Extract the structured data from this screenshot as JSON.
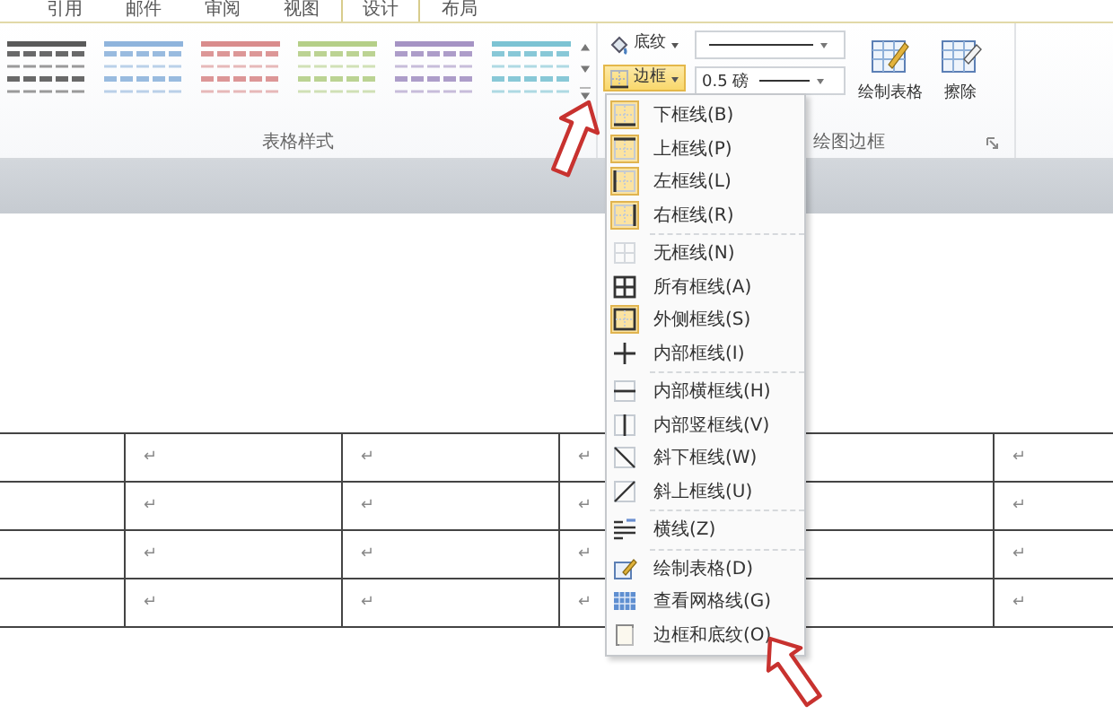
{
  "tabs": [
    {
      "label": "引用",
      "selected": false
    },
    {
      "label": "邮件",
      "selected": false
    },
    {
      "label": "审阅",
      "selected": false
    },
    {
      "label": "视图",
      "selected": false
    },
    {
      "label": "设计",
      "selected": true
    },
    {
      "label": "布局",
      "selected": false
    }
  ],
  "table_styles": {
    "styles": [
      {
        "color": "#5a5a5a"
      },
      {
        "color": "#8fb4dc"
      },
      {
        "color": "#d98c8c"
      },
      {
        "color": "#b5cf88"
      },
      {
        "color": "#a593c4"
      },
      {
        "color": "#7cc3d3"
      }
    ],
    "label": "表格样式"
  },
  "draw_borders": {
    "shading": "底纹",
    "borders": "边框",
    "line_weight": "0.5 磅",
    "draw_table": "绘制表格",
    "eraser": "擦除",
    "label": "绘图边框"
  },
  "menu": {
    "groups": [
      [
        {
          "label": "下框线(B)",
          "checked": true
        },
        {
          "label": "上框线(P)",
          "checked": true
        },
        {
          "label": "左框线(L)",
          "checked": true
        },
        {
          "label": "右框线(R)",
          "checked": true
        }
      ],
      [
        {
          "label": "无框线(N)",
          "checked": false
        },
        {
          "label": "所有框线(A)",
          "checked": false
        },
        {
          "label": "外侧框线(S)",
          "checked": true
        },
        {
          "label": "内部框线(I)",
          "checked": false
        }
      ],
      [
        {
          "label": "内部横框线(H)",
          "checked": false
        },
        {
          "label": "内部竖框线(V)",
          "checked": false
        },
        {
          "label": "斜下框线(W)",
          "checked": false
        },
        {
          "label": "斜上框线(U)",
          "checked": false
        }
      ],
      [
        {
          "label": "横线(Z)",
          "checked": false
        }
      ],
      [
        {
          "label": "绘制表格(D)",
          "checked": false
        },
        {
          "label": "查看网格线(G)",
          "checked": false
        },
        {
          "label": "边框和底纹(O)",
          "checked": false
        }
      ]
    ]
  },
  "table": {
    "rows": [
      {
        "cells": [
          "↵",
          "↵",
          "↵",
          "↵"
        ]
      },
      {
        "cells": [
          "↵",
          "↵",
          "↵",
          "↵"
        ]
      },
      {
        "cells": [
          "↵",
          "↵",
          "↵",
          "↵"
        ]
      },
      {
        "cells": [
          "↵",
          "↵",
          "↵",
          "↵"
        ]
      }
    ]
  }
}
